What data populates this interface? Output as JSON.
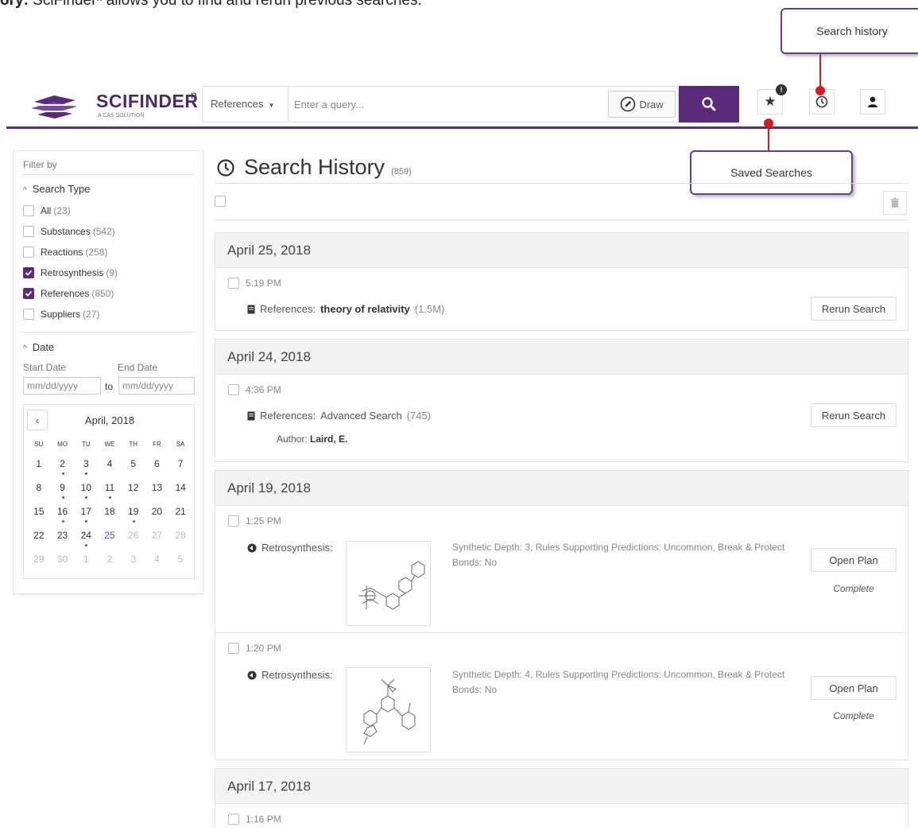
{
  "caption": {
    "bold": "ory:",
    "text": " SciFinderⁿ allows you to find and rerun previous searches."
  },
  "app": {
    "name": "SCIFINDER",
    "sup": "n",
    "sub": "A CAS SOLUTION"
  },
  "search": {
    "type_label": "References",
    "placeholder": "Enter a query...",
    "draw_label": "Draw"
  },
  "header_icons": {
    "saved_badge": "!"
  },
  "callouts": {
    "search_history": "Search  history",
    "saved_searches": "Saved  Searches"
  },
  "sidebar": {
    "filter_by": "Filter by",
    "search_type_title": "Search Type",
    "types": [
      {
        "label": "All",
        "count": "(23)",
        "checked": false
      },
      {
        "label": "Substances",
        "count": "(542)",
        "checked": false
      },
      {
        "label": "Reactions",
        "count": "(258)",
        "checked": false
      },
      {
        "label": "Retrosynthesis",
        "count": "(9)",
        "checked": true
      },
      {
        "label": "References",
        "count": "(850)",
        "checked": true
      },
      {
        "label": "Suppliers",
        "count": "(27)",
        "checked": false
      }
    ],
    "date_title": "Date",
    "start_label": "Start Date",
    "end_label": "End Date",
    "start_placeholder": "mm/dd/yyyy",
    "end_placeholder": "mm/dd/yyyy",
    "to_label": "to",
    "calendar": {
      "title": "April, 2018",
      "dows": [
        "SU",
        "MO",
        "TU",
        "WE",
        "TH",
        "FR",
        "SA"
      ],
      "days": [
        {
          "d": "1",
          "s": ""
        },
        {
          "d": "2",
          "s": "dot"
        },
        {
          "d": "3",
          "s": "dot"
        },
        {
          "d": "4",
          "s": ""
        },
        {
          "d": "5",
          "s": ""
        },
        {
          "d": "6",
          "s": ""
        },
        {
          "d": "7",
          "s": ""
        },
        {
          "d": "8",
          "s": ""
        },
        {
          "d": "9",
          "s": "dot"
        },
        {
          "d": "10",
          "s": "dot"
        },
        {
          "d": "11",
          "s": "dot"
        },
        {
          "d": "12",
          "s": ""
        },
        {
          "d": "13",
          "s": ""
        },
        {
          "d": "14",
          "s": ""
        },
        {
          "d": "15",
          "s": ""
        },
        {
          "d": "16",
          "s": "dot"
        },
        {
          "d": "17",
          "s": "dot"
        },
        {
          "d": "18",
          "s": ""
        },
        {
          "d": "19",
          "s": "dot"
        },
        {
          "d": "20",
          "s": ""
        },
        {
          "d": "21",
          "s": ""
        },
        {
          "d": "22",
          "s": ""
        },
        {
          "d": "23",
          "s": ""
        },
        {
          "d": "24",
          "s": "dot"
        },
        {
          "d": "25",
          "s": "accent"
        },
        {
          "d": "26",
          "s": "faded"
        },
        {
          "d": "27",
          "s": "faded"
        },
        {
          "d": "28",
          "s": "faded"
        },
        {
          "d": "29",
          "s": "faded"
        },
        {
          "d": "30",
          "s": "faded"
        },
        {
          "d": "1",
          "s": "faded"
        },
        {
          "d": "2",
          "s": "faded"
        },
        {
          "d": "3",
          "s": "faded"
        },
        {
          "d": "4",
          "s": "faded"
        },
        {
          "d": "5",
          "s": "faded"
        }
      ]
    }
  },
  "main": {
    "title": "Search History",
    "count": "(859)",
    "groups": [
      {
        "date": "April 25, 2018",
        "entries": [
          {
            "time": "5:19 PM",
            "type": "References:",
            "query": "theory of relativity",
            "count": "(1.5M)",
            "action": "Rerun Search"
          }
        ]
      },
      {
        "date": "April 24, 2018",
        "entries": [
          {
            "time": "4:36 PM",
            "type": "References:",
            "query": "Advanced Search",
            "count": "(745)",
            "sub_label": "Author:",
            "sub_value": "Laird, E.",
            "action": "Rerun Search"
          }
        ]
      },
      {
        "date": "April 19, 2018",
        "entries": [
          {
            "time": "1:25 PM",
            "type": "Retrosynthesis:",
            "desc": "Synthetic Depth: 3, Rules Supporting Predictions: Uncommon, Break & Protect Bonds: No",
            "action": "Open Plan",
            "status": "Complete"
          },
          {
            "time": "1:20 PM",
            "type": "Retrosynthesis:",
            "desc": "Synthetic Depth: 4, Rules Supporting Predictions: Uncommon, Break & Protect Bonds: No",
            "action": "Open Plan",
            "status": "Complete"
          }
        ]
      },
      {
        "date": "April 17, 2018",
        "entries": [
          {
            "time": "1:16 PM"
          }
        ]
      }
    ]
  },
  "colors": {
    "brand": "#5b2a78",
    "callout_border": "#6a3b92",
    "pin": "#d71920"
  }
}
